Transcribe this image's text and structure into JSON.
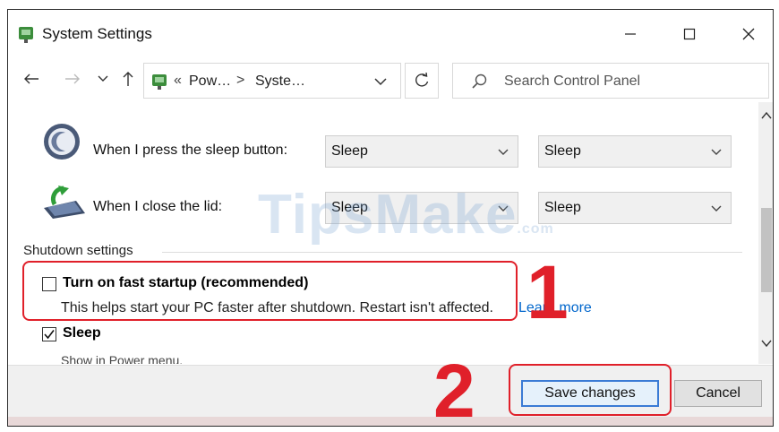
{
  "window": {
    "title": "System Settings",
    "controls": {
      "minimize": "minimize-icon",
      "maximize": "maximize-icon",
      "close": "close-icon"
    }
  },
  "address_bar": {
    "prefix": "«",
    "crumbs": [
      "Pow…",
      "Syste…"
    ],
    "separator": ">",
    "search_placeholder": "Search Control Panel"
  },
  "power_rows": [
    {
      "label": "When I press the sleep button:",
      "on_battery": "Sleep",
      "plugged_in": "Sleep",
      "icon": "sleep-button-icon"
    },
    {
      "label": "When I close the lid:",
      "on_battery": "Sleep",
      "plugged_in": "Sleep",
      "icon": "laptop-lid-icon"
    }
  ],
  "shutdown": {
    "title": "Shutdown settings",
    "items": [
      {
        "label": "Turn on fast startup (recommended)",
        "checked": false,
        "description": "This helps start your PC faster after shutdown. Restart isn't affected.",
        "link": "Learn more"
      },
      {
        "label": "Sleep",
        "checked": true,
        "description": "Show in Power menu."
      }
    ]
  },
  "footer": {
    "save_label": "Save changes",
    "cancel_label": "Cancel"
  },
  "annotations": {
    "step1": "1",
    "step2": "2"
  },
  "watermark": {
    "main": "TipsMake",
    "suffix": ".com"
  },
  "colors": {
    "accent": "#0066cc",
    "annotation": "#e0202a",
    "button_focus": "#3a7bd5"
  }
}
